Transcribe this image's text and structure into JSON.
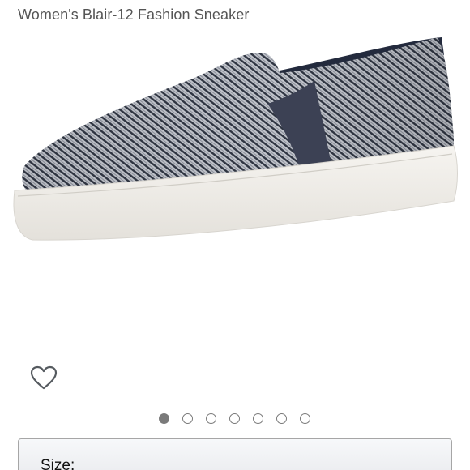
{
  "product": {
    "title": "Women's Blair-12 Fashion Sneaker"
  },
  "image": {
    "subject": "gray striped slip-on sneaker with navy elastic gore and white sole",
    "colors": {
      "upper": "#b9bcc4",
      "stripes": "#2f3542",
      "gore": "#3c4154",
      "lining": "#232a3d",
      "sole": "#f1efea"
    }
  },
  "wishlist": {
    "icon": "heart-outline-icon"
  },
  "carousel": {
    "count": 7,
    "active_index": 0
  },
  "size_selector": {
    "label": "Size:"
  }
}
